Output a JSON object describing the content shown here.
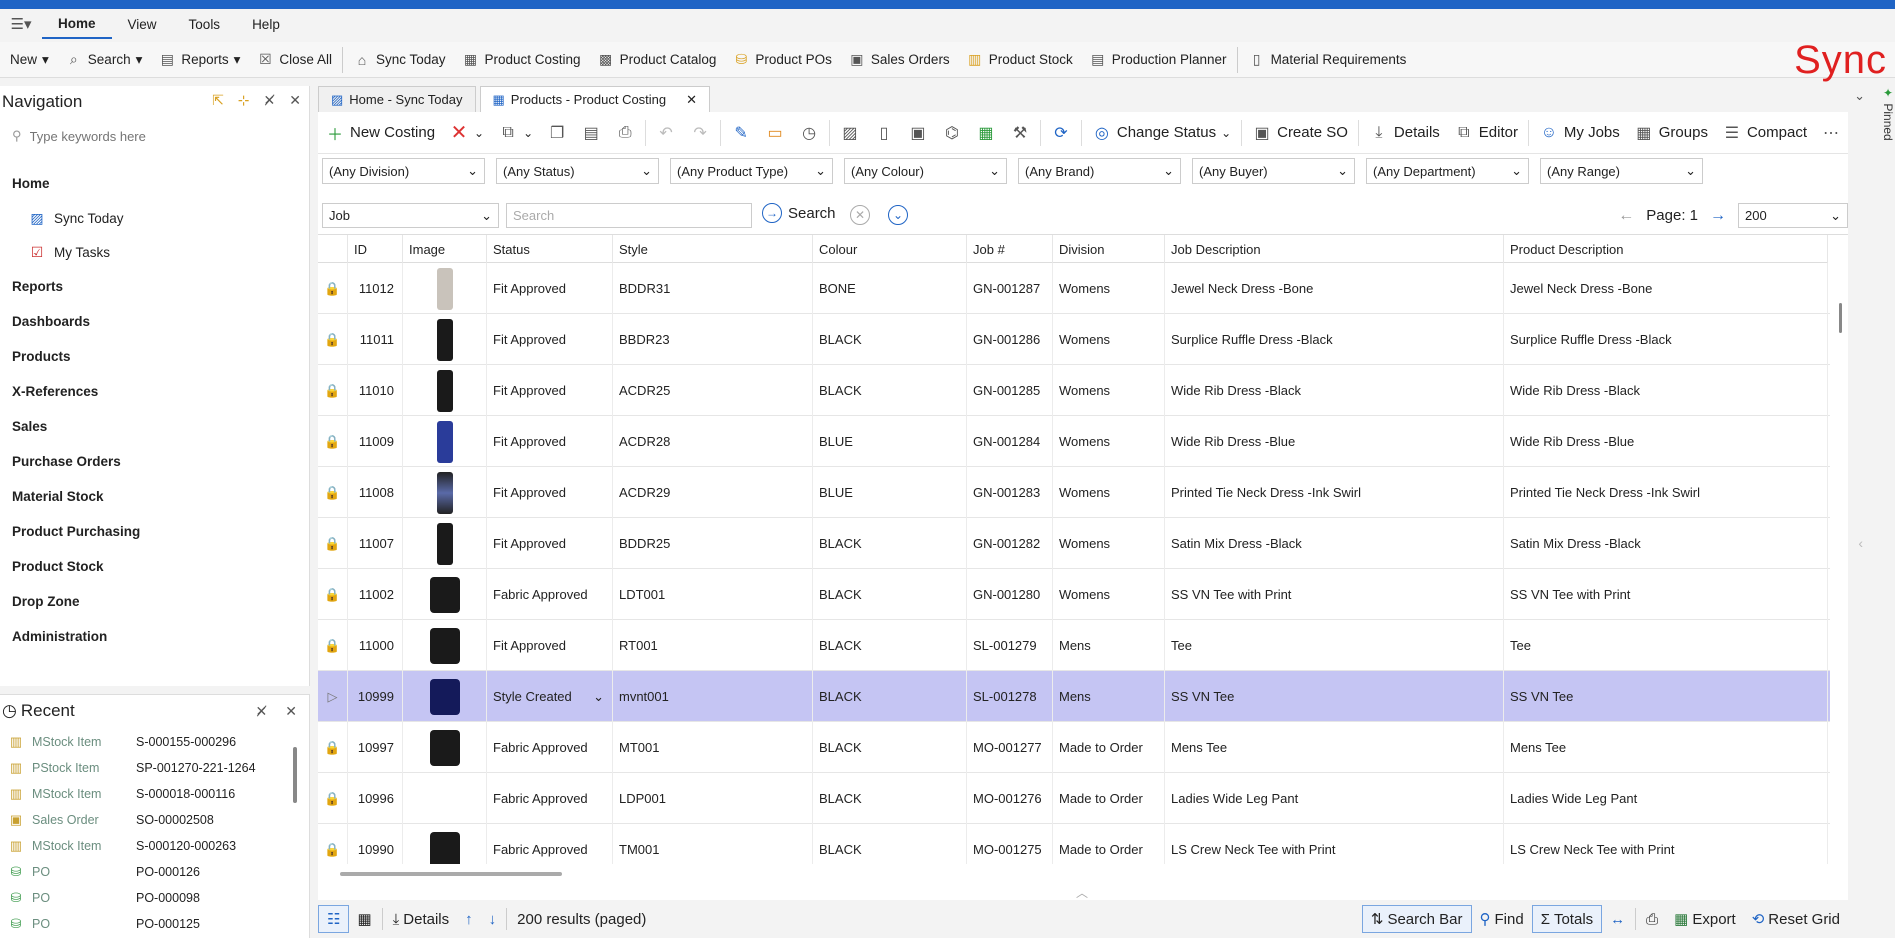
{
  "menubar": {
    "items": [
      "Home",
      "View",
      "Tools",
      "Help"
    ]
  },
  "toolbar": {
    "new_label": "New",
    "search_label": "Search",
    "reports_label": "Reports",
    "close_all_label": "Close All",
    "sync_today_label": "Sync Today",
    "product_costing_label": "Product Costing",
    "product_catalog_label": "Product Catalog",
    "product_pos_label": "Product POs",
    "sales_orders_label": "Sales Orders",
    "product_stock_label": "Product Stock",
    "production_planner_label": "Production Planner",
    "material_requirements_label": "Material Requirements"
  },
  "logo_text": "Sync",
  "pinned_label": "Pinned",
  "navigation": {
    "title": "Navigation",
    "search_placeholder": "Type keywords here",
    "home_label": "Home",
    "sync_today_label": "Sync Today",
    "my_tasks_label": "My Tasks",
    "sections": [
      "Reports",
      "Dashboards",
      "Products",
      "X-References",
      "Sales",
      "Purchase Orders",
      "Material Stock",
      "Product Purchasing",
      "Product Stock",
      "Drop Zone",
      "Administration"
    ]
  },
  "recent": {
    "title": "Recent",
    "items": [
      {
        "type": "MStock Item",
        "value": "S-000155-000296"
      },
      {
        "type": "PStock Item",
        "value": "SP-001270-221-1264"
      },
      {
        "type": "MStock Item",
        "value": "S-000018-000116"
      },
      {
        "type": "Sales Order",
        "value": "SO-00002508"
      },
      {
        "type": "MStock Item",
        "value": "S-000120-000263"
      },
      {
        "type": "PO",
        "value": "PO-000126"
      },
      {
        "type": "PO",
        "value": "PO-000098"
      },
      {
        "type": "PO",
        "value": "PO-000125"
      }
    ]
  },
  "doc_tabs": {
    "tab1": "Home - Sync Today",
    "tab2": "Products - Product Costing"
  },
  "actions": {
    "new_costing": "New Costing",
    "change_status": "Change Status",
    "create_so": "Create SO",
    "details": "Details",
    "editor": "Editor",
    "my_jobs": "My Jobs",
    "groups": "Groups",
    "compact": "Compact"
  },
  "filters": [
    "(Any Division)",
    "(Any Status)",
    "(Any Product Type)",
    "(Any Colour)",
    "(Any Brand)",
    "(Any Buyer)",
    "(Any Department)",
    "(Any Range)"
  ],
  "search": {
    "field_selected": "Job",
    "placeholder": "Search",
    "button_label": "Search"
  },
  "pager": {
    "page_label": "Page: 1",
    "page_size": "200"
  },
  "grid": {
    "columns": [
      "ID",
      "Image",
      "Status",
      "Style",
      "Colour",
      "Job #",
      "Division",
      "Job Description",
      "Product Description"
    ],
    "rows": [
      {
        "id": "11012",
        "status": "Fit Approved",
        "style": " BDDR31",
        "colour": "BONE",
        "job": "GN-001287",
        "division": "Womens",
        "job_desc": "Jewel Neck Dress -Bone",
        "prod_desc": "Jewel Neck Dress -Bone"
      },
      {
        "id": "11011",
        "status": "Fit Approved",
        "style": "BBDR23",
        "colour": "BLACK",
        "job": "GN-001286",
        "division": "Womens",
        "job_desc": "Surplice Ruffle Dress -Black",
        "prod_desc": "Surplice Ruffle Dress -Black"
      },
      {
        "id": "11010",
        "status": "Fit Approved",
        "style": "ACDR25",
        "colour": "BLACK",
        "job": "GN-001285",
        "division": "Womens",
        "job_desc": "Wide Rib Dress -Black",
        "prod_desc": "Wide Rib Dress -Black"
      },
      {
        "id": "11009",
        "status": "Fit Approved",
        "style": "ACDR28",
        "colour": "BLUE",
        "job": "GN-001284",
        "division": "Womens",
        "job_desc": "Wide Rib Dress -Blue",
        "prod_desc": "Wide Rib Dress -Blue"
      },
      {
        "id": "11008",
        "status": "Fit Approved",
        "style": "ACDR29",
        "colour": "BLUE",
        "job": "GN-001283",
        "division": "Womens",
        "job_desc": "Printed Tie Neck Dress -Ink Swirl",
        "prod_desc": "Printed Tie Neck Dress -Ink Swirl"
      },
      {
        "id": "11007",
        "status": "Fit Approved",
        "style": " BDDR25",
        "colour": "BLACK",
        "job": "GN-001282",
        "division": "Womens",
        "job_desc": "Satin Mix Dress -Black",
        "prod_desc": "Satin Mix Dress -Black"
      },
      {
        "id": "11002",
        "status": "Fabric Approved",
        "style": "LDT001",
        "colour": "BLACK",
        "job": "GN-001280",
        "division": "Womens",
        "job_desc": "SS VN Tee with Print",
        "prod_desc": "SS VN Tee with Print"
      },
      {
        "id": "11000",
        "status": "Fit Approved",
        "style": "RT001",
        "colour": "BLACK",
        "job": "SL-001279",
        "division": "Mens",
        "job_desc": "Tee",
        "prod_desc": "Tee"
      },
      {
        "id": "10999",
        "status": "Style Created",
        "style": "mvnt001",
        "colour": "BLACK",
        "job": "SL-001278",
        "division": "Mens",
        "job_desc": "SS VN Tee",
        "prod_desc": "SS VN Tee"
      },
      {
        "id": "10997",
        "status": "Fabric Approved",
        "style": "MT001",
        "colour": "BLACK",
        "job": "MO-001277",
        "division": "Made to Order",
        "job_desc": "Mens Tee",
        "prod_desc": "Mens Tee"
      },
      {
        "id": "10996",
        "status": "Fabric Approved",
        "style": "LDP001",
        "colour": "BLACK",
        "job": "MO-001276",
        "division": "Made to Order",
        "job_desc": "Ladies Wide Leg Pant",
        "prod_desc": "Ladies Wide Leg Pant"
      },
      {
        "id": "10990",
        "status": "Fabric Approved",
        "style": "TM001",
        "colour": "BLACK",
        "job": "MO-001275",
        "division": "Made to Order",
        "job_desc": "LS Crew Neck Tee with Print",
        "prod_desc": "LS Crew Neck Tee with Print"
      }
    ]
  },
  "status_bar": {
    "details": "Details",
    "results": "200 results (paged)",
    "search_bar": "Search Bar",
    "find": "Find",
    "totals": "Totals",
    "export": "Export",
    "reset_grid": "Reset Grid"
  },
  "colors": {
    "accent": "#1f64c5",
    "selected_row": "#c5c5f3",
    "lock": "#d9a020",
    "logo": "#e02020"
  }
}
